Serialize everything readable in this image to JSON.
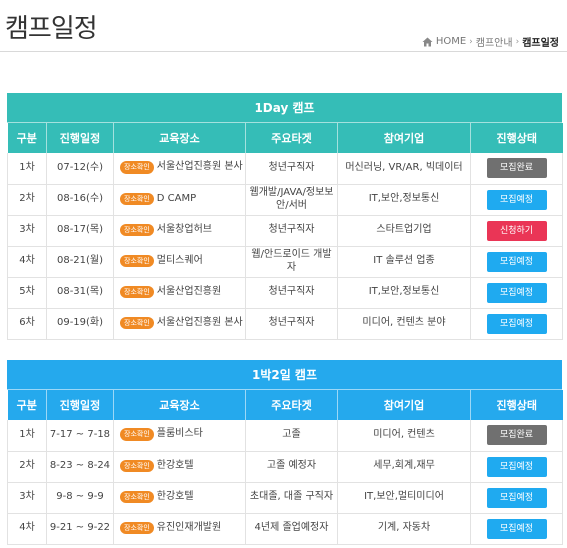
{
  "page": {
    "title": "캠프일정",
    "breadcrumb": {
      "home": "HOME",
      "parent": "캠프안내",
      "current": "캠프일정"
    }
  },
  "columns": [
    "구분",
    "진행일정",
    "교육장소",
    "주요타겟",
    "참여기업",
    "진행상태"
  ],
  "location_badge": "장소확인",
  "colors": {
    "section1_header": "#35bdb7",
    "section2_header": "#25a9ed",
    "badge_orange": "#f08a24",
    "status_closed": "#707070",
    "status_scheduled": "#1faaf0",
    "status_apply": "#ea3556"
  },
  "sections": [
    {
      "title": "1Day 캠프",
      "rows": [
        {
          "round": "1차",
          "date": "07-12(수)",
          "place": "서울산업진흥원 본사",
          "target": "청년구직자",
          "company": "머신러닝, VR/AR, 빅데이터",
          "status": "모집완료",
          "status_type": "closed"
        },
        {
          "round": "2차",
          "date": "08-16(수)",
          "place": "D CAMP",
          "target": "웹개발/JAVA/정보보안/서버",
          "company": "IT,보안,정보통신",
          "status": "모집예정",
          "status_type": "scheduled"
        },
        {
          "round": "3차",
          "date": "08-17(목)",
          "place": "서울창업허브",
          "target": "청년구직자",
          "company": "스타트업기업",
          "status": "신청하기",
          "status_type": "apply"
        },
        {
          "round": "4차",
          "date": "08-21(월)",
          "place": "멀티스퀘어",
          "target": "웹/안드로이드 개발자",
          "company": "IT 솔루션 업종",
          "status": "모집예정",
          "status_type": "scheduled"
        },
        {
          "round": "5차",
          "date": "08-31(목)",
          "place": "서울산업진흥원",
          "target": "청년구직자",
          "company": "IT,보안,정보통신",
          "status": "모집예정",
          "status_type": "scheduled"
        },
        {
          "round": "6차",
          "date": "09-19(화)",
          "place": "서울산업진흥원 본사",
          "target": "청년구직자",
          "company": "미디어, 컨텐츠 분야",
          "status": "모집예정",
          "status_type": "scheduled"
        }
      ]
    },
    {
      "title": "1박2일 캠프",
      "rows": [
        {
          "round": "1차",
          "date": "7-17 ~ 7-18",
          "place": "플룸비스타",
          "target": "고졸",
          "company": "미디어, 컨텐츠",
          "status": "모집완료",
          "status_type": "closed"
        },
        {
          "round": "2차",
          "date": "8-23 ~ 8-24",
          "place": "한강호텔",
          "target": "고졸 예정자",
          "company": "세무,회계,재무",
          "status": "모집예정",
          "status_type": "scheduled"
        },
        {
          "round": "3차",
          "date": "9-8 ~ 9-9",
          "place": "한강호텔",
          "target": "초대졸, 대졸 구직자",
          "company": "IT,보안,멀티미디어",
          "status": "모집예정",
          "status_type": "scheduled"
        },
        {
          "round": "4차",
          "date": "9-21 ~ 9-22",
          "place": "유진인재개발원",
          "target": "4년제 졸업예정자",
          "company": "기계, 자동차",
          "status": "모집예정",
          "status_type": "scheduled"
        }
      ]
    }
  ]
}
